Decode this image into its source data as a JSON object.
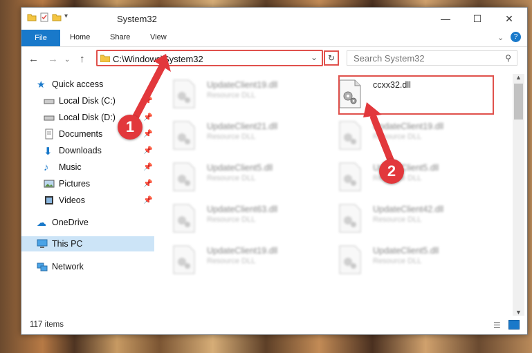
{
  "window": {
    "title": "System32"
  },
  "ribbon": {
    "file": "File",
    "tabs": [
      "Home",
      "Share",
      "View"
    ]
  },
  "address": {
    "path": "C:\\Windows\\System32"
  },
  "search": {
    "placeholder": "Search System32"
  },
  "sidebar": {
    "quick_access": "Quick access",
    "items": [
      "Local Disk (C:)",
      "Local Disk (D:)",
      "Documents",
      "Downloads",
      "Music",
      "Pictures",
      "Videos"
    ],
    "onedrive": "OneDrive",
    "this_pc": "This PC",
    "network": "Network"
  },
  "files": {
    "target": {
      "name": "ccxx32.dll"
    },
    "left": [
      {
        "name": "UpdateClient19.dll",
        "type": "Resource DLL"
      },
      {
        "name": "UpdateClient21.dll",
        "type": "Resource DLL"
      },
      {
        "name": "UpdateClient5.dll",
        "type": "Resource DLL"
      },
      {
        "name": "UpdateClient63.dll",
        "type": "Resource DLL"
      },
      {
        "name": "UpdateClient19.dll",
        "type": "Resource DLL"
      }
    ],
    "right": [
      {
        "name": "UpdateClient19.dll",
        "type": "Resource DLL"
      },
      {
        "name": "UpdateClient5.dll",
        "type": "Resource DLL"
      },
      {
        "name": "UpdateClient42.dll",
        "type": "Resource DLL"
      },
      {
        "name": "UpdateClient5.dll",
        "type": "Resource DLL"
      }
    ]
  },
  "status": {
    "count": "117 items"
  },
  "annotations": {
    "step1": "1",
    "step2": "2"
  },
  "colors": {
    "accent": "#1979ca",
    "highlight": "#e0514c",
    "badge": "#e2383c"
  }
}
